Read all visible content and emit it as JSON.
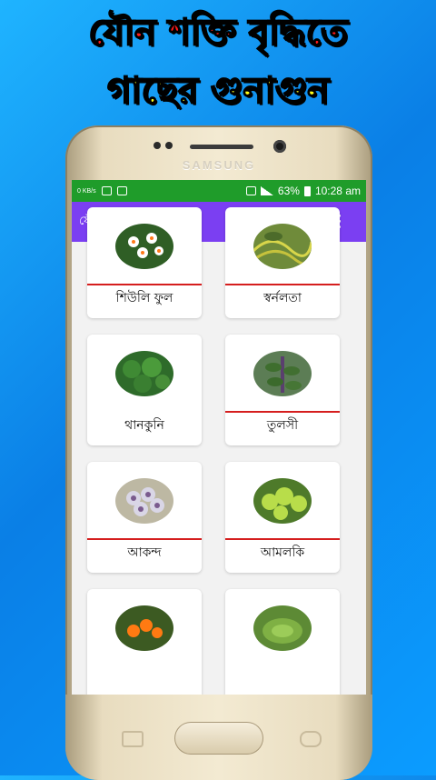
{
  "promo": {
    "line1": "যৌন শক্তি বৃদ্ধিতে",
    "line2": "গাছের গুনাগুন"
  },
  "phone": {
    "brand": "SAMSUNG"
  },
  "status_bar": {
    "carrier_small": "0 KB/s",
    "battery": "63%",
    "time": "10:28 am"
  },
  "app_bar": {
    "title": "যৌন শক্তি বৃদ্ধি গাছে...",
    "info_icon": "info-icon",
    "share_icon": "share-icon",
    "more_icon": "more-vert-icon",
    "color": "#7b3ff2"
  },
  "items": [
    {
      "label": "শিউলি ফুল",
      "icon": "night-jasmine-image"
    },
    {
      "label": "স্বর্নলতা",
      "icon": "golden-dodder-image"
    },
    {
      "label": "থানকুনি",
      "icon": "centella-image"
    },
    {
      "label": "তুলসী",
      "icon": "tulsi-image"
    },
    {
      "label": "আকন্দ",
      "icon": "calotropis-image"
    },
    {
      "label": "আমলকি",
      "icon": "amla-image"
    },
    {
      "label": "",
      "icon": "orange-berries-image"
    },
    {
      "label": "",
      "icon": "green-plant-image"
    }
  ],
  "colors": {
    "status_bar": "#1f9c2a",
    "divider": "#d51e1e",
    "background_blue": "#0a7fe6"
  }
}
